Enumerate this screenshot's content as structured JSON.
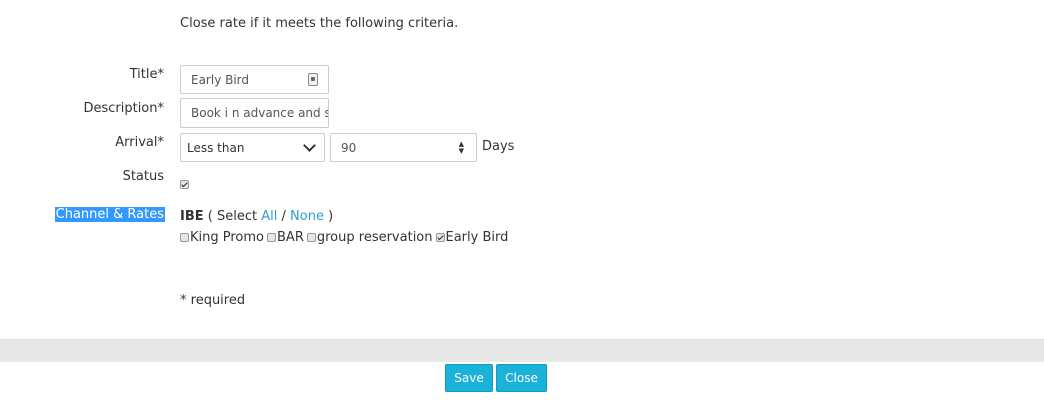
{
  "intro": "Close rate if it meets the following criteria.",
  "labels": {
    "title": "Title*",
    "description": "Description*",
    "arrival": "Arrival*",
    "status": "Status",
    "channel_rates": "Channel & Rates"
  },
  "fields": {
    "title_value": "Early Bird",
    "description_value": "Book i n advance and sa",
    "arrival_option": "Less than",
    "arrival_days": "90",
    "days_label": "Days",
    "status_checked": true
  },
  "channel": {
    "name": "IBE",
    "select_prefix": "( Select",
    "all_label": "All",
    "separator": "/",
    "none_label": "None",
    "select_suffix": ")",
    "rates": [
      {
        "label": "King Promo",
        "checked": false
      },
      {
        "label": "BAR",
        "checked": false
      },
      {
        "label": "group reservation",
        "checked": false
      },
      {
        "label": "Early Bird",
        "checked": true
      }
    ]
  },
  "required_note": "* required",
  "buttons": {
    "save": "Save",
    "close": "Close"
  },
  "colors": {
    "accent": "#1ab2d8",
    "link": "#2a9fd6",
    "highlight": "#3399ff"
  }
}
